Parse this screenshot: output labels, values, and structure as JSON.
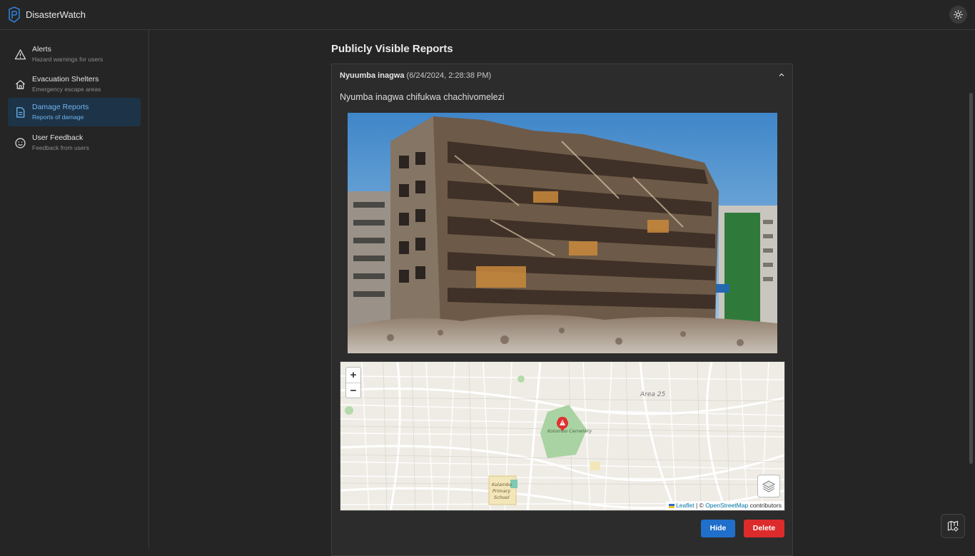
{
  "app": {
    "title": "DisasterWatch"
  },
  "sidebar": {
    "items": [
      {
        "label": "Alerts",
        "sub": "Hazard warnings for users",
        "icon": "alert-triangle-icon"
      },
      {
        "label": "Evacuation Shelters",
        "sub": "Emergency escape areas",
        "icon": "home-icon"
      },
      {
        "label": "Damage Reports",
        "sub": "Reports of damage",
        "icon": "document-icon"
      },
      {
        "label": "User Feedback",
        "sub": "Feedback from users",
        "icon": "smiley-icon"
      }
    ],
    "active": "Damage Reports"
  },
  "main": {
    "heading": "Publicly Visible Reports",
    "report": {
      "author": "Nyuumba inagwa",
      "timestamp": "(6/24/2024, 2:28:38 PM)",
      "description": "Nyumba inagwa chifukwa chachivomelezi",
      "map": {
        "zoom_in": "+",
        "zoom_out": "−",
        "labels": {
          "area": "Area 25",
          "cemetery": "Kolombo Cemetery",
          "school_1": "Kolambo",
          "school_2": "Primary",
          "school_3": "School"
        },
        "attribution": {
          "leaflet": "Leaflet",
          "sep": "| ©",
          "osm": "OpenStreetMap",
          "contrib": "contributors"
        }
      },
      "actions": {
        "hide": "Hide",
        "delete": "Delete"
      }
    }
  },
  "colors": {
    "accent": "#1f6fcb",
    "danger": "#dc2b2b",
    "active_bg": "#1d3347",
    "active_text": "#6fb6f2",
    "marker": "#e03131"
  }
}
